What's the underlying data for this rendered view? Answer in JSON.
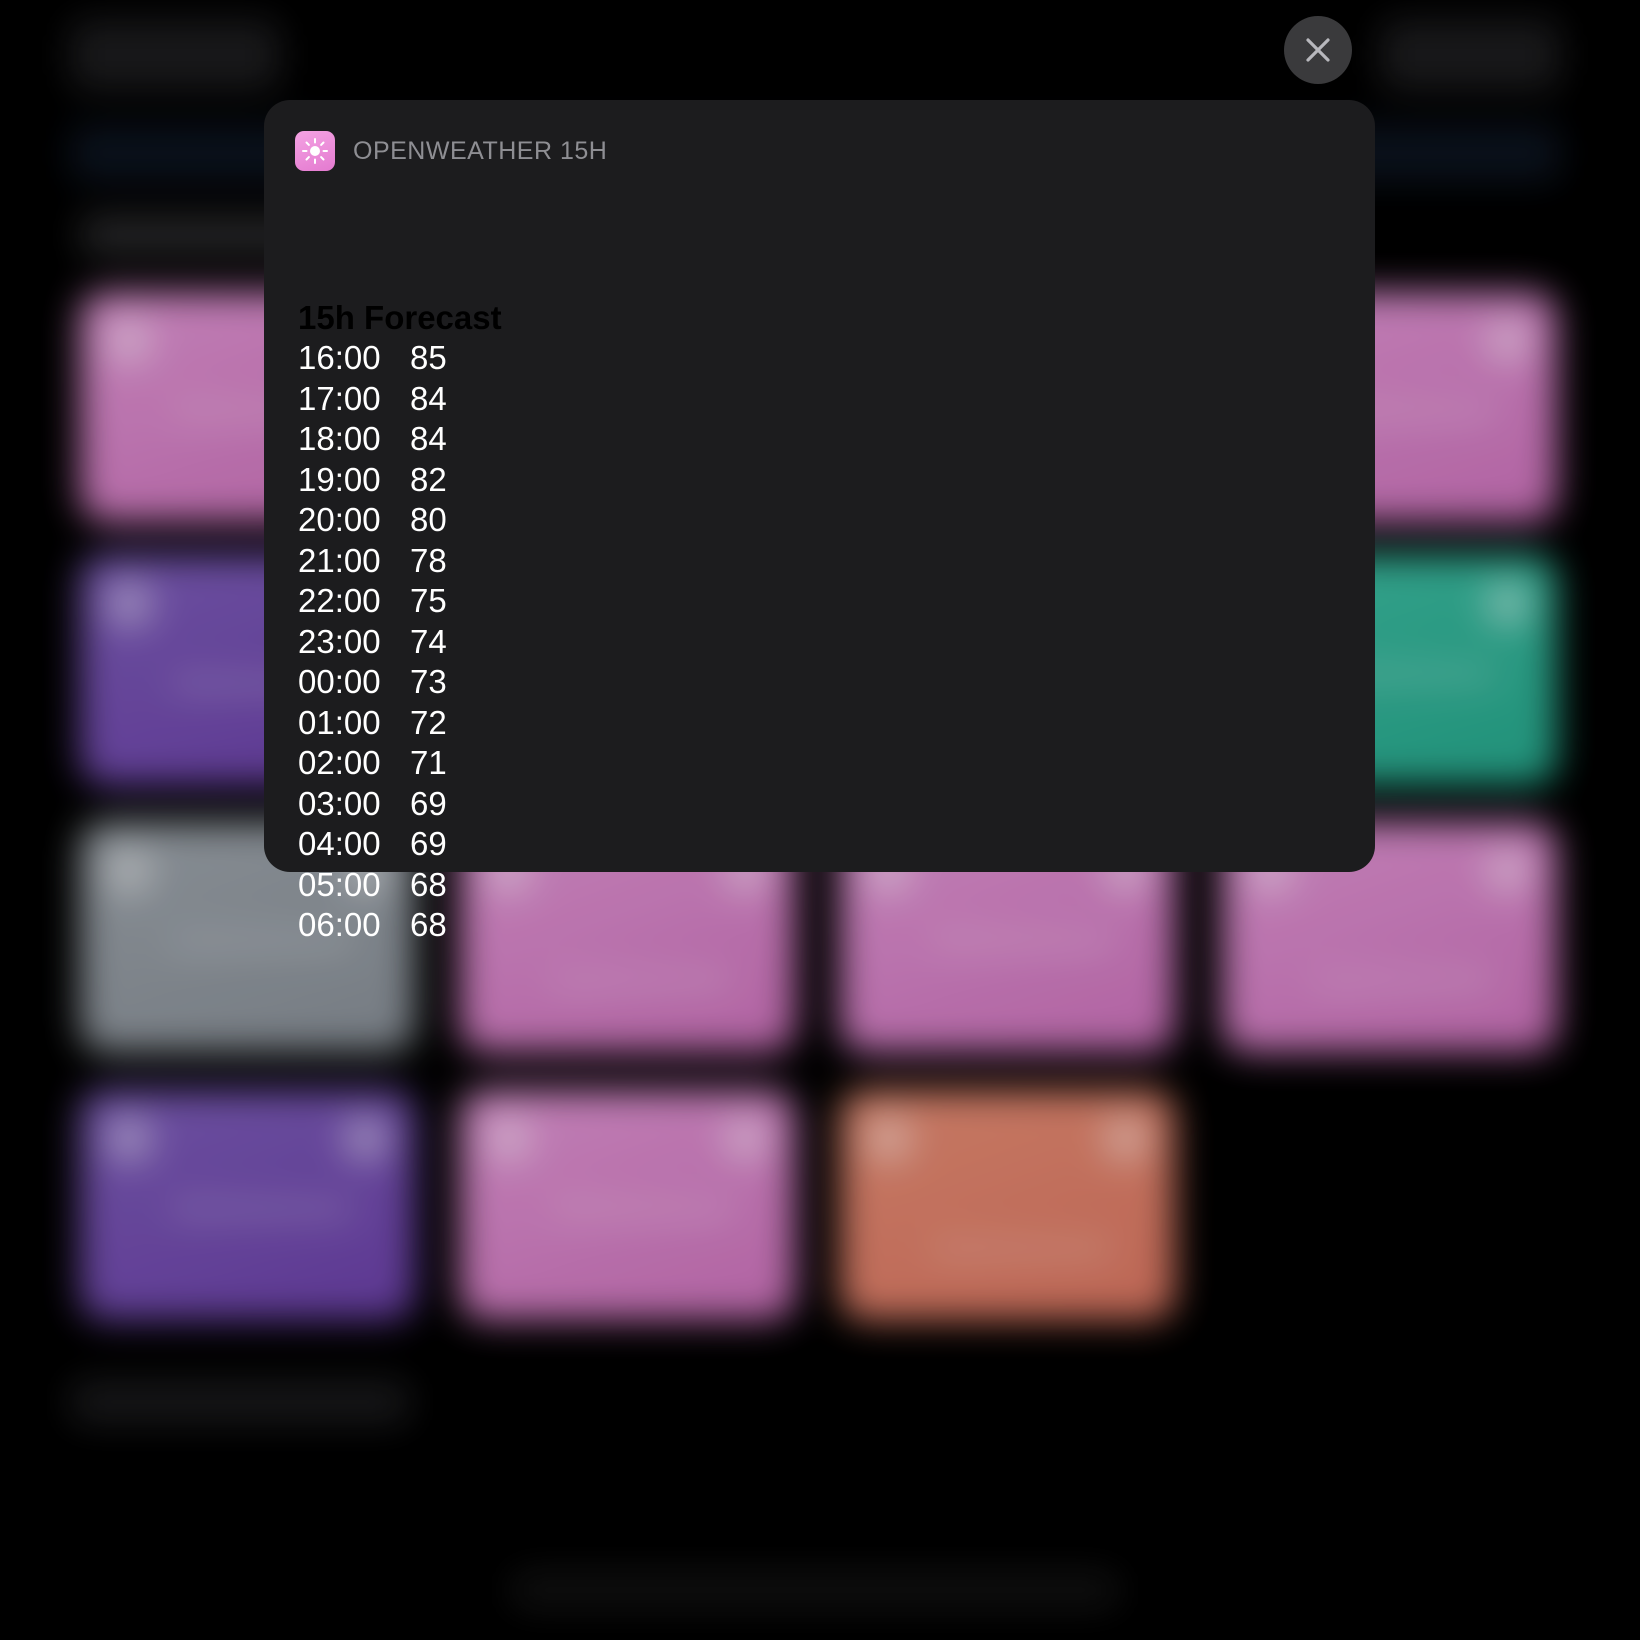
{
  "notification": {
    "app_name": "OPENWEATHER 15H",
    "app_icon": "sun-icon",
    "title": "15h Forecast",
    "forecast": [
      {
        "time": "16:00",
        "temp": "85"
      },
      {
        "time": "17:00",
        "temp": "84"
      },
      {
        "time": "18:00",
        "temp": "84"
      },
      {
        "time": "19:00",
        "temp": "82"
      },
      {
        "time": "20:00",
        "temp": "80"
      },
      {
        "time": "21:00",
        "temp": "78"
      },
      {
        "time": "22:00",
        "temp": "75"
      },
      {
        "time": "23:00",
        "temp": "74"
      },
      {
        "time": "00:00",
        "temp": "73"
      },
      {
        "time": "01:00",
        "temp": "72"
      },
      {
        "time": "02:00",
        "temp": "71"
      },
      {
        "time": "03:00",
        "temp": "69"
      },
      {
        "time": "04:00",
        "temp": "69"
      },
      {
        "time": "05:00",
        "temp": "68"
      },
      {
        "time": "06:00",
        "temp": "68"
      }
    ]
  },
  "close_button": {
    "icon": "close-icon"
  },
  "background": {
    "tile_colors": {
      "pink": "#d07fc4",
      "purple": "#7450ad",
      "gray": "#8f969d",
      "green": "#2fb095",
      "orange": "#dc7e68"
    }
  }
}
